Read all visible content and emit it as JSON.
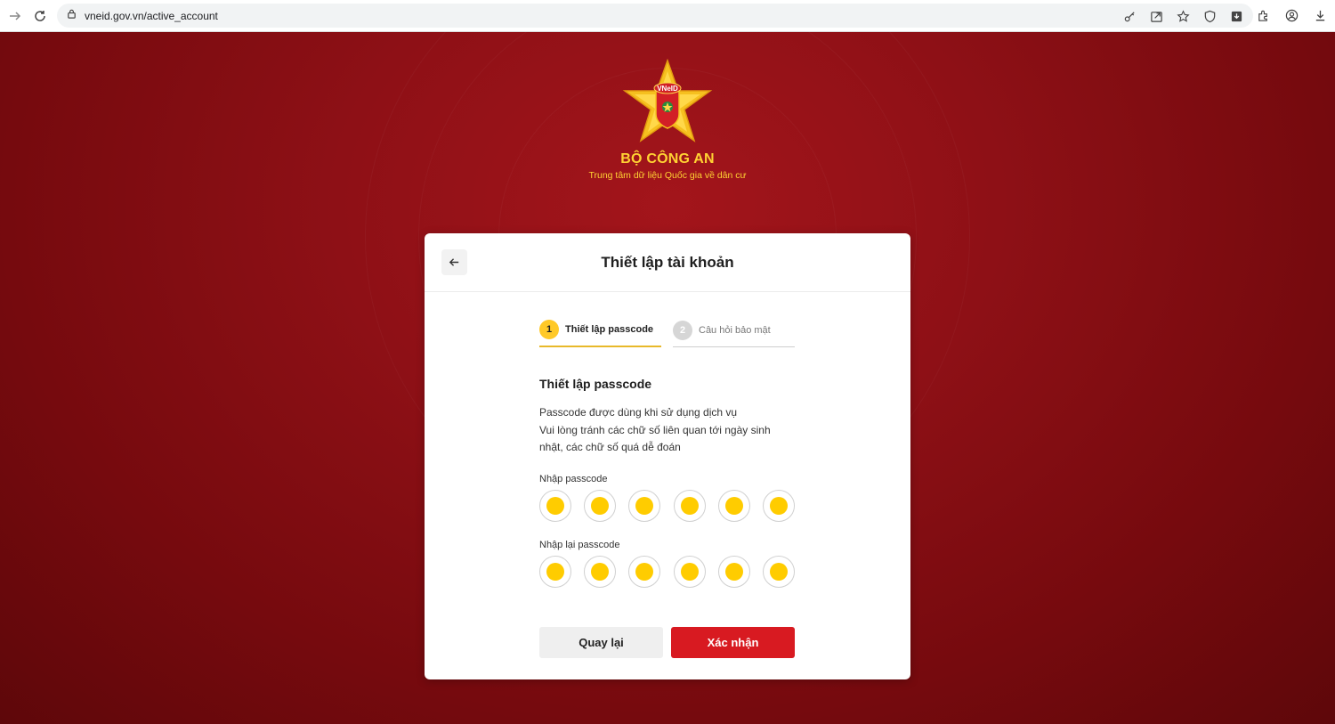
{
  "browser": {
    "url": "vneid.gov.vn/active_account"
  },
  "header": {
    "org_title": "BỘ CÔNG AN",
    "org_subtitle": "Trung tâm dữ liệu Quốc gia về dân cư",
    "logo_text": "VNeID"
  },
  "card": {
    "title": "Thiết lập tài khoản",
    "steps": [
      {
        "number": "1",
        "label": "Thiết lập passcode",
        "active": true
      },
      {
        "number": "2",
        "label": "Câu hỏi bảo mật",
        "active": false
      }
    ],
    "section_title": "Thiết lập passcode",
    "description_lines": [
      "Passcode được dùng khi sử dụng dịch vụ",
      "Vui lòng tránh các chữ số liên quan tới ngày sinh",
      "nhật, các chữ số quá dễ đoán"
    ],
    "passcode_label": "Nhập passcode",
    "confirm_passcode_label": "Nhập lại passcode",
    "passcode_filled": 6,
    "confirm_passcode_filled": 6,
    "back_button": "Quay lại",
    "confirm_button": "Xác nhận"
  },
  "colors": {
    "accent_yellow": "#ffcc00",
    "primary_red": "#d81a21",
    "background_red": "#8e1016"
  }
}
